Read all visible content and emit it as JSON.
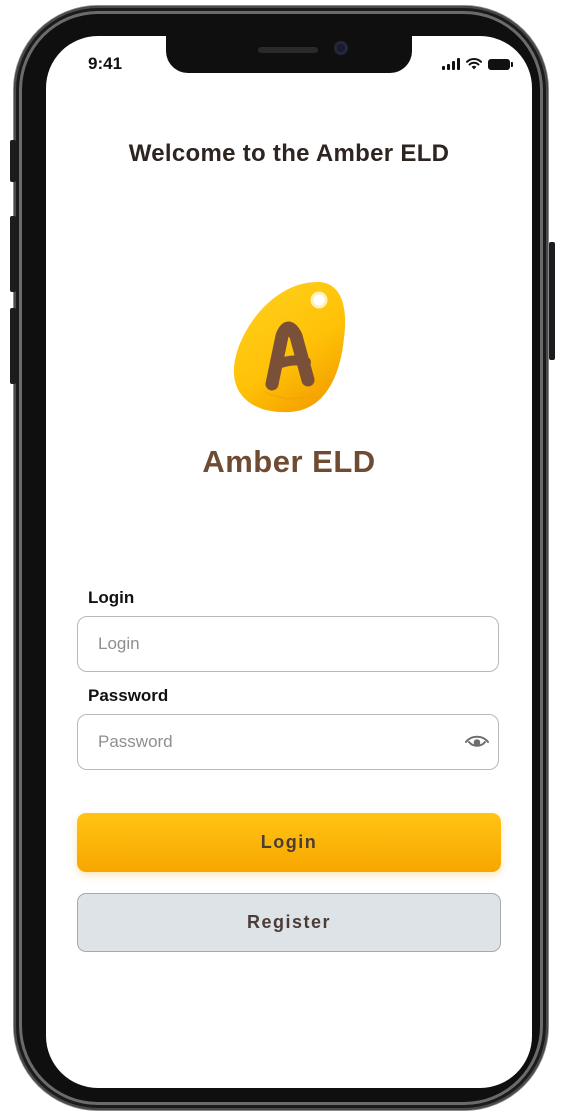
{
  "status_bar": {
    "time": "9:41"
  },
  "welcome_title": "Welcome to the Amber ELD",
  "logo": {
    "letter": "A"
  },
  "brand_name": "Amber ELD",
  "login_field": {
    "label": "Login",
    "placeholder": "Login",
    "value": ""
  },
  "password_field": {
    "label": "Password",
    "placeholder": "Password",
    "value": ""
  },
  "buttons": {
    "login": "Login",
    "register": "Register"
  },
  "colors": {
    "accent": "#ffc107",
    "brand_text": "#6e4b32",
    "register_bg": "#dde3e6"
  }
}
